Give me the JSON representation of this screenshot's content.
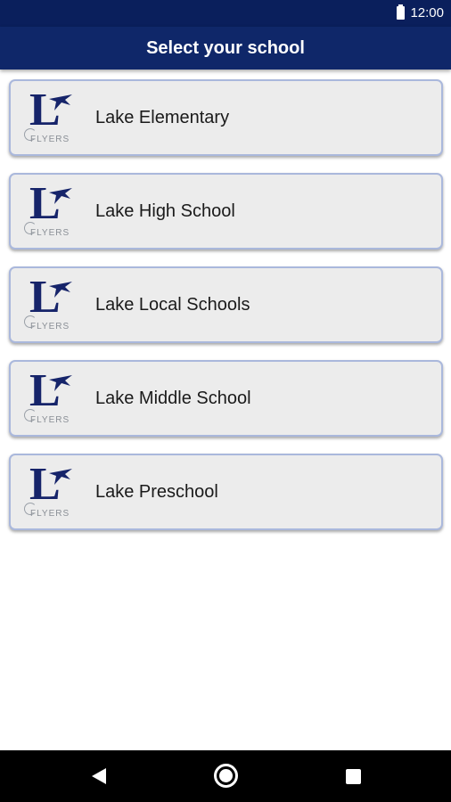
{
  "status_bar": {
    "time": "12:00",
    "battery_icon": "battery-full-icon"
  },
  "app_bar": {
    "title": "Select your school"
  },
  "schools": [
    {
      "name": "Lake Elementary",
      "logo_letter": "L",
      "logo_text": "FLYERS"
    },
    {
      "name": "Lake High School",
      "logo_letter": "L",
      "logo_text": "FLYERS"
    },
    {
      "name": "Lake Local Schools",
      "logo_letter": "L",
      "logo_text": "FLYERS"
    },
    {
      "name": "Lake Middle School",
      "logo_letter": "L",
      "logo_text": "FLYERS"
    },
    {
      "name": "Lake Preschool",
      "logo_letter": "L",
      "logo_text": "FLYERS"
    }
  ],
  "nav_bar": {
    "back_icon": "back-triangle-icon",
    "home_icon": "home-circle-icon",
    "recents_icon": "recents-square-icon"
  },
  "colors": {
    "status_bar": "#0a1f5c",
    "app_bar": "#0f2769",
    "card_background": "#ececec",
    "card_border": "#aab8dc",
    "logo_navy": "#16246a"
  }
}
